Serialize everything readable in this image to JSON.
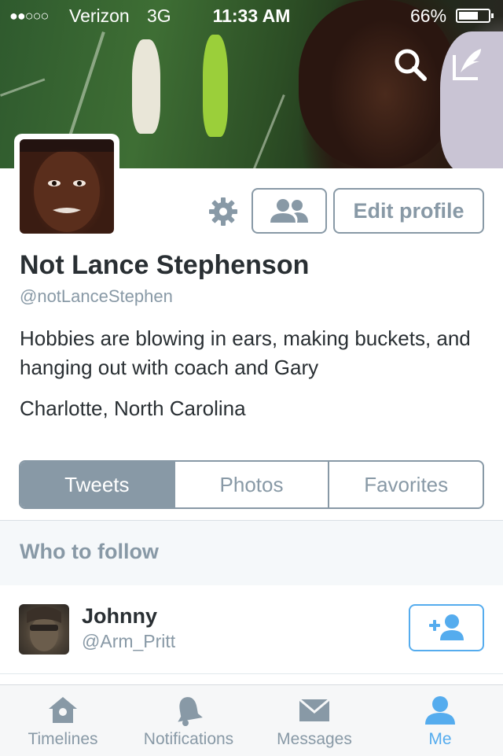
{
  "status_bar": {
    "signal": "●●○○○",
    "carrier": "Verizon",
    "network": "3G",
    "time": "11:33 AM",
    "battery_percent": "66%",
    "battery_level": 0.66
  },
  "header": {
    "search_icon": "search-icon",
    "compose_icon": "compose-tweet-icon"
  },
  "profile": {
    "name": "Not Lance Stephenson",
    "handle": "@notLanceStephen",
    "bio": "Hobbies are blowing in ears, making buckets, and hanging out with coach and Gary",
    "location": "Charlotte, North Carolina",
    "edit_label": "Edit profile"
  },
  "segments": {
    "items": [
      {
        "label": "Tweets",
        "active": true
      },
      {
        "label": "Photos",
        "active": false
      },
      {
        "label": "Favorites",
        "active": false
      }
    ]
  },
  "who_to_follow": {
    "title": "Who to follow",
    "suggestions": [
      {
        "name": "Johnny",
        "handle": "@Arm_Pritt"
      }
    ]
  },
  "tabbar": {
    "items": [
      {
        "label": "Timelines",
        "icon": "home-icon",
        "active": false
      },
      {
        "label": "Notifications",
        "icon": "bell-icon",
        "active": false
      },
      {
        "label": "Messages",
        "icon": "envelope-icon",
        "active": false
      },
      {
        "label": "Me",
        "icon": "person-icon",
        "active": true
      }
    ]
  },
  "colors": {
    "accent": "#55acee",
    "muted": "#8899a6",
    "text": "#292f33"
  }
}
